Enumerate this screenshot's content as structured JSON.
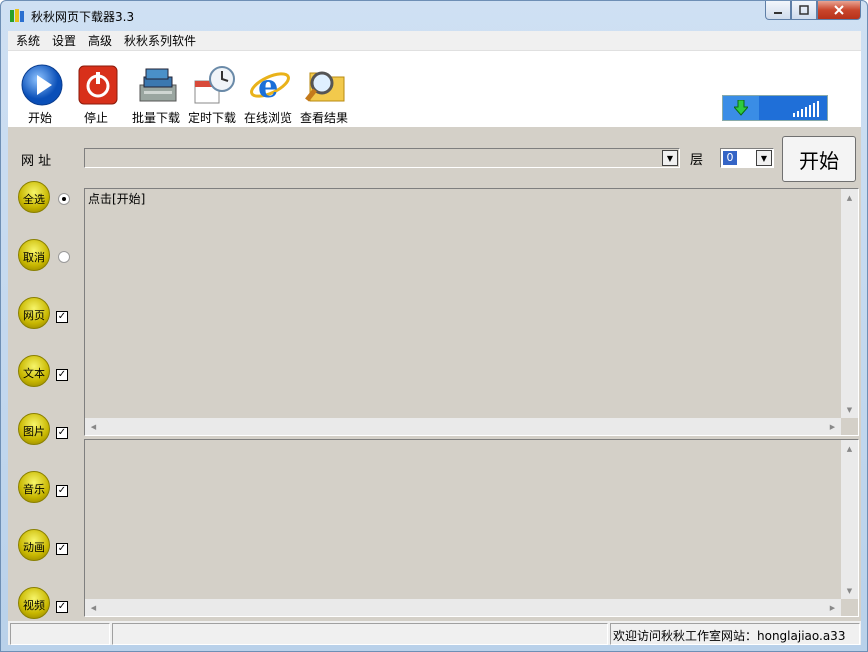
{
  "window": {
    "title": "秋秋网页下载器3.3"
  },
  "menu": [
    "系统",
    "设置",
    "高级",
    "秋秋系列软件"
  ],
  "toolbar": [
    {
      "label": "开始",
      "icon": "play-icon"
    },
    {
      "label": "停止",
      "icon": "power-icon"
    },
    {
      "label": "批量下载",
      "icon": "batch-download-icon"
    },
    {
      "label": "定时下载",
      "icon": "scheduled-download-icon"
    },
    {
      "label": "在线浏览",
      "icon": "ie-browser-icon"
    },
    {
      "label": "查看结果",
      "icon": "view-results-icon"
    }
  ],
  "address": {
    "label": "网 址",
    "value": "",
    "layer_label": "层",
    "layer_value": "0",
    "start_button": "开始"
  },
  "options": [
    {
      "label": "全选",
      "type": "radio",
      "checked": true
    },
    {
      "label": "取消",
      "type": "radio",
      "checked": false
    },
    {
      "label": "网页",
      "type": "checkbox",
      "checked": true
    },
    {
      "label": "文本",
      "type": "checkbox",
      "checked": true
    },
    {
      "label": "图片",
      "type": "checkbox",
      "checked": true
    },
    {
      "label": "音乐",
      "type": "checkbox",
      "checked": true
    },
    {
      "label": "动画",
      "type": "checkbox",
      "checked": true
    },
    {
      "label": "视频",
      "type": "checkbox",
      "checked": true
    }
  ],
  "log_text": "点击[开始]",
  "status": {
    "cell1": "",
    "cell2": "",
    "cell3": "欢迎访问秋秋工作室网站：honglajiao.a33"
  },
  "colors": {
    "title_bg": "#cfe0f3",
    "client_bg": "#d4d0c8",
    "accent": "#1f6fd8"
  }
}
